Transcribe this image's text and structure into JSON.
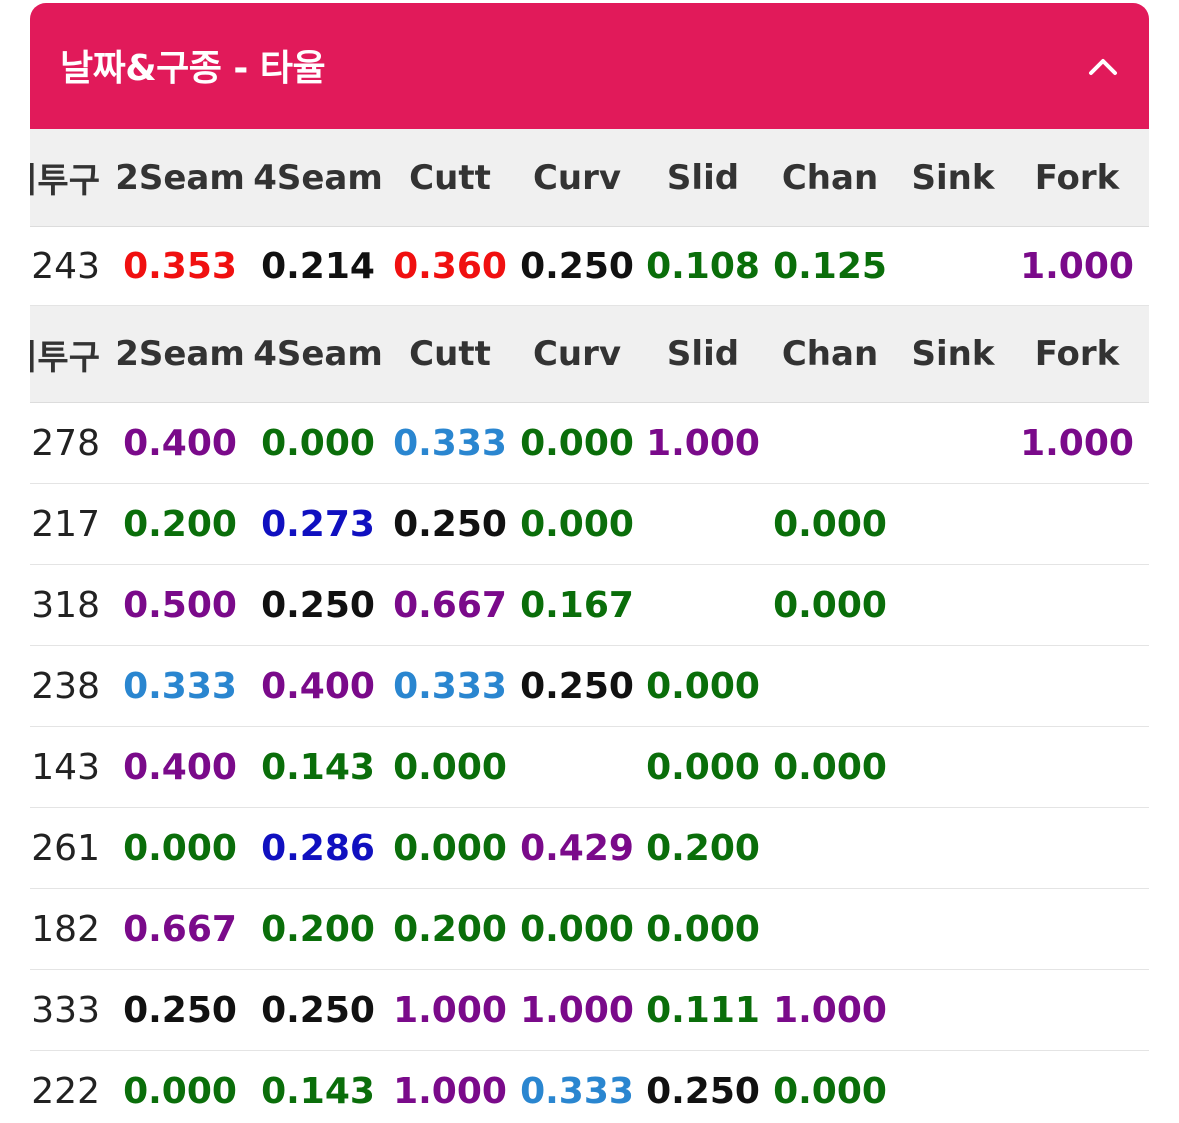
{
  "header": {
    "title": "날짜&구종 - 타율",
    "toggle_icon": "chevron-up-icon"
  },
  "columns": [
    "리투구",
    "2Seam",
    "4Seam",
    "Cutt",
    "Curv",
    "Slid",
    "Chan",
    "Sink",
    "Fork"
  ],
  "colors": {
    "red": "#f01010",
    "black": "#111111",
    "green": "#0a6e0a",
    "purple": "#7a0a8a",
    "lightblue": "#2a86d0",
    "blue": "#1010c0"
  },
  "rows": [
    {
      "type": "header"
    },
    {
      "type": "data",
      "cells": [
        {
          "t": "243",
          "c": "plain"
        },
        {
          "t": "0.353",
          "c": "red"
        },
        {
          "t": "0.214",
          "c": "black"
        },
        {
          "t": "0.360",
          "c": "red"
        },
        {
          "t": "0.250",
          "c": "black"
        },
        {
          "t": "0.108",
          "c": "green"
        },
        {
          "t": "0.125",
          "c": "green"
        },
        {
          "t": "",
          "c": "plain"
        },
        {
          "t": "1.000",
          "c": "purple"
        }
      ]
    },
    {
      "type": "header"
    },
    {
      "type": "data",
      "cells": [
        {
          "t": "278",
          "c": "plain"
        },
        {
          "t": "0.400",
          "c": "purple"
        },
        {
          "t": "0.000",
          "c": "green"
        },
        {
          "t": "0.333",
          "c": "lightblue"
        },
        {
          "t": "0.000",
          "c": "green"
        },
        {
          "t": "1.000",
          "c": "purple"
        },
        {
          "t": "",
          "c": "plain"
        },
        {
          "t": "",
          "c": "plain"
        },
        {
          "t": "1.000",
          "c": "purple"
        }
      ]
    },
    {
      "type": "data",
      "cells": [
        {
          "t": "217",
          "c": "plain"
        },
        {
          "t": "0.200",
          "c": "green"
        },
        {
          "t": "0.273",
          "c": "blue"
        },
        {
          "t": "0.250",
          "c": "black"
        },
        {
          "t": "0.000",
          "c": "green"
        },
        {
          "t": "",
          "c": "plain"
        },
        {
          "t": "0.000",
          "c": "green"
        },
        {
          "t": "",
          "c": "plain"
        },
        {
          "t": "",
          "c": "plain"
        }
      ]
    },
    {
      "type": "data",
      "cells": [
        {
          "t": "318",
          "c": "plain"
        },
        {
          "t": "0.500",
          "c": "purple"
        },
        {
          "t": "0.250",
          "c": "black"
        },
        {
          "t": "0.667",
          "c": "purple"
        },
        {
          "t": "0.167",
          "c": "green"
        },
        {
          "t": "",
          "c": "plain"
        },
        {
          "t": "0.000",
          "c": "green"
        },
        {
          "t": "",
          "c": "plain"
        },
        {
          "t": "",
          "c": "plain"
        }
      ]
    },
    {
      "type": "data",
      "cells": [
        {
          "t": "238",
          "c": "plain"
        },
        {
          "t": "0.333",
          "c": "lightblue"
        },
        {
          "t": "0.400",
          "c": "purple"
        },
        {
          "t": "0.333",
          "c": "lightblue"
        },
        {
          "t": "0.250",
          "c": "black"
        },
        {
          "t": "0.000",
          "c": "green"
        },
        {
          "t": "",
          "c": "plain"
        },
        {
          "t": "",
          "c": "plain"
        },
        {
          "t": "",
          "c": "plain"
        }
      ]
    },
    {
      "type": "data",
      "cells": [
        {
          "t": "143",
          "c": "plain"
        },
        {
          "t": "0.400",
          "c": "purple"
        },
        {
          "t": "0.143",
          "c": "green"
        },
        {
          "t": "0.000",
          "c": "green"
        },
        {
          "t": "",
          "c": "plain"
        },
        {
          "t": "0.000",
          "c": "green"
        },
        {
          "t": "0.000",
          "c": "green"
        },
        {
          "t": "",
          "c": "plain"
        },
        {
          "t": "",
          "c": "plain"
        }
      ]
    },
    {
      "type": "data",
      "cells": [
        {
          "t": "261",
          "c": "plain"
        },
        {
          "t": "0.000",
          "c": "green"
        },
        {
          "t": "0.286",
          "c": "blue"
        },
        {
          "t": "0.000",
          "c": "green"
        },
        {
          "t": "0.429",
          "c": "purple"
        },
        {
          "t": "0.200",
          "c": "green"
        },
        {
          "t": "",
          "c": "plain"
        },
        {
          "t": "",
          "c": "plain"
        },
        {
          "t": "",
          "c": "plain"
        }
      ]
    },
    {
      "type": "data",
      "cells": [
        {
          "t": "182",
          "c": "plain"
        },
        {
          "t": "0.667",
          "c": "purple"
        },
        {
          "t": "0.200",
          "c": "green"
        },
        {
          "t": "0.200",
          "c": "green"
        },
        {
          "t": "0.000",
          "c": "green"
        },
        {
          "t": "0.000",
          "c": "green"
        },
        {
          "t": "",
          "c": "plain"
        },
        {
          "t": "",
          "c": "plain"
        },
        {
          "t": "",
          "c": "plain"
        }
      ]
    },
    {
      "type": "data",
      "cells": [
        {
          "t": "333",
          "c": "plain"
        },
        {
          "t": "0.250",
          "c": "black"
        },
        {
          "t": "0.250",
          "c": "black"
        },
        {
          "t": "1.000",
          "c": "purple"
        },
        {
          "t": "1.000",
          "c": "purple"
        },
        {
          "t": "0.111",
          "c": "green"
        },
        {
          "t": "1.000",
          "c": "purple"
        },
        {
          "t": "",
          "c": "plain"
        },
        {
          "t": "",
          "c": "plain"
        }
      ]
    },
    {
      "type": "data",
      "cells": [
        {
          "t": "222",
          "c": "plain"
        },
        {
          "t": "0.000",
          "c": "green"
        },
        {
          "t": "0.143",
          "c": "green"
        },
        {
          "t": "1.000",
          "c": "purple"
        },
        {
          "t": "0.333",
          "c": "lightblue"
        },
        {
          "t": "0.250",
          "c": "black"
        },
        {
          "t": "0.000",
          "c": "green"
        },
        {
          "t": "",
          "c": "plain"
        },
        {
          "t": "",
          "c": "plain"
        }
      ]
    }
  ]
}
